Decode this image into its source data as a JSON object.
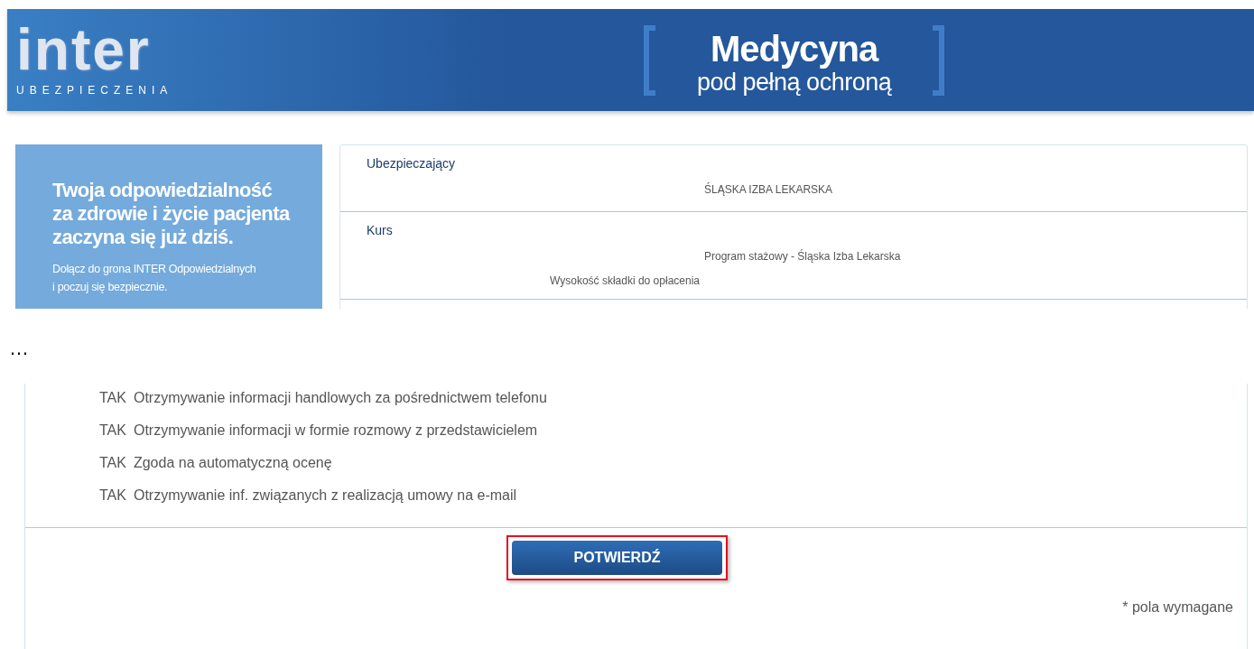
{
  "header": {
    "logo": {
      "wordmark": "inter",
      "subtitle": "UBEZPIECZENIA"
    },
    "tagline": [
      "Medycyna",
      "pod pełną ochroną"
    ]
  },
  "promo": {
    "headline": [
      "Twoja odpowiedzialność",
      "za zdrowie i życie pacjenta",
      "zaczyna się już dziś."
    ],
    "text": [
      "Dołącz do grona INTER Odpowiedzialnych",
      "i poczuj się bezpiecznie."
    ]
  },
  "summary": {
    "sections": [
      {
        "label": "Ubezpieczający",
        "values": [
          "ŚLĄSKA IZBA LEKARSKA"
        ]
      },
      {
        "label": "Kurs",
        "values": [
          "Program stażowy - Śląska Izba Lekarska"
        ],
        "note": "Wysokość składki do opłacenia"
      }
    ]
  },
  "separator": "…",
  "consents": [
    {
      "answer": "TAK",
      "text": "Otrzymywanie informacji handlowych za pośrednictwem telefonu"
    },
    {
      "answer": "TAK",
      "text": "Otrzymywanie informacji w formie rozmowy z przedstawicielem"
    },
    {
      "answer": "TAK",
      "text": "Zgoda na automatyczną ocenę"
    },
    {
      "answer": "TAK",
      "text": "Otrzymywanie inf. związanych z realizacją umowy na e-mail"
    }
  ],
  "confirm_button": {
    "label": "POTWIERDŹ",
    "highlighted": true
  },
  "required_note": "* pola wymagane"
}
